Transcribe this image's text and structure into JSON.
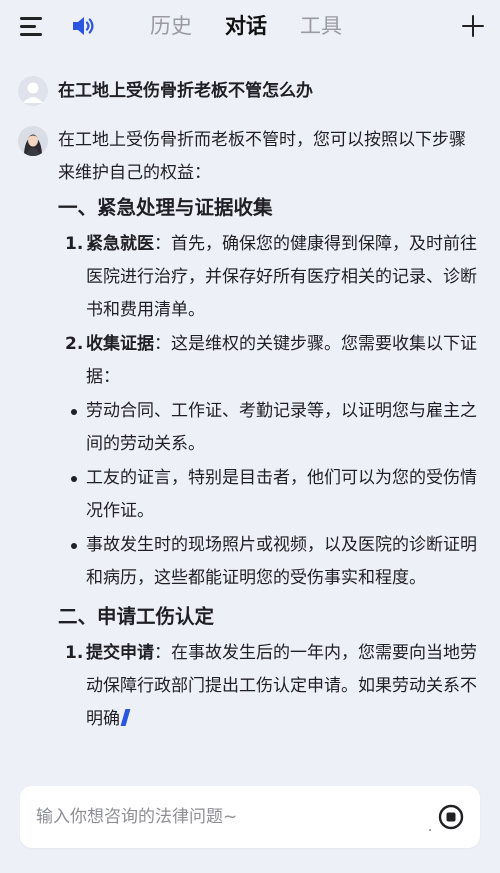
{
  "header": {
    "tabs": [
      {
        "label": "历史"
      },
      {
        "label": "对话"
      },
      {
        "label": "工具"
      }
    ],
    "active_tab": "对话"
  },
  "user_message": {
    "text": "在工地上受伤骨折老板不管怎么办"
  },
  "answer": {
    "intro": "在工地上受伤骨折而老板不管时，您可以按照以下步骤来维护自己的权益：",
    "sections": [
      {
        "heading": "一、紧急处理与证据收集",
        "items": [
          {
            "number": "1.",
            "title": "紧急就医",
            "text": "：首先，确保您的健康得到保障，及时前往医院进行治疗，并保存好所有医疗相关的记录、诊断书和费用清单。"
          },
          {
            "number": "2.",
            "title": "收集证据",
            "text": "：这是维权的关键步骤。您需要收集以下证据："
          }
        ],
        "bullets": [
          "劳动合同、工作证、考勤记录等，以证明您与雇主之间的劳动关系。",
          "工友的证言，特别是目击者，他们可以为您的受伤情况作证。",
          "事故发生时的现场照片或视频，以及医院的诊断证明和病历，这些都能证明您的受伤事实和程度。"
        ]
      },
      {
        "heading": "二、申请工伤认定",
        "items": [
          {
            "number": "1.",
            "title": "提交申请",
            "text": "：在事故发生后的一年内，您需要向当地劳动保障行政部门提出工伤认定申请。如果劳动关系不明确"
          }
        ]
      }
    ]
  },
  "input": {
    "placeholder": "输入你想咨询的法律问题~"
  },
  "icons": {
    "menu": "menu-icon",
    "speaker": "speaker-icon",
    "add": "plus-icon",
    "stop": "stop-icon"
  },
  "colors": {
    "accent": "#2a55e0",
    "background": "#eef0f7"
  }
}
